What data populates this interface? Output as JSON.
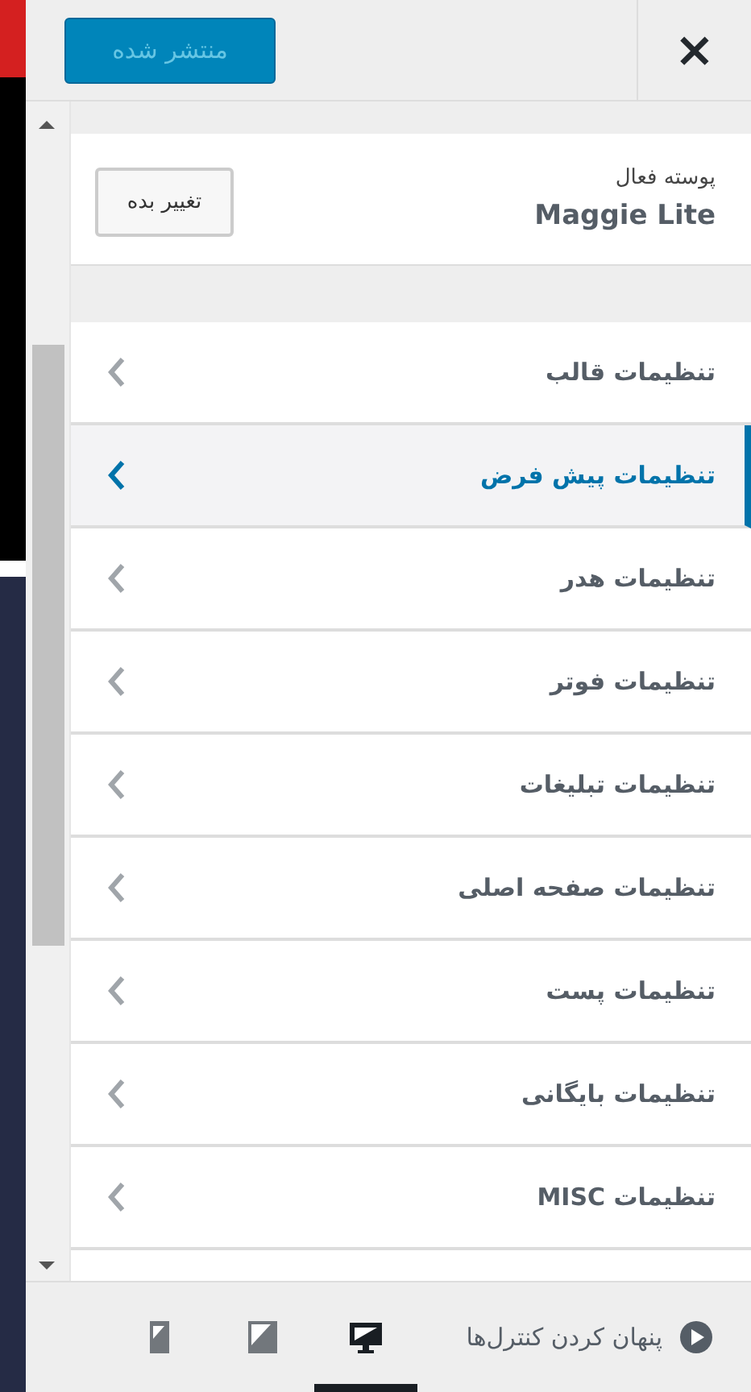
{
  "header": {
    "close": "×",
    "publish_button": "منتشر شده"
  },
  "active_theme": {
    "label": "پوسته فعال",
    "name": "Maggie Lite",
    "change_button": "تغییر بده"
  },
  "menu": [
    {
      "label": "تنظیمات قالب",
      "selected": false
    },
    {
      "label": "تنظیمات پیش فرض",
      "selected": true
    },
    {
      "label": "تنظیمات هدر",
      "selected": false
    },
    {
      "label": "تنظیمات فوتر",
      "selected": false
    },
    {
      "label": "تنظیمات تبلیغات",
      "selected": false
    },
    {
      "label": "تنظیمات صفحه اصلی",
      "selected": false
    },
    {
      "label": "تنظیمات پست",
      "selected": false
    },
    {
      "label": "تنظیمات بایگانی",
      "selected": false
    },
    {
      "label": "تنظیمات MISC",
      "selected": false
    }
  ],
  "footer": {
    "hide_controls": "پنهان کردن کنترل‌ها",
    "devices": [
      {
        "kind": "desktop",
        "selected": true
      },
      {
        "kind": "tablet",
        "selected": false
      },
      {
        "kind": "mobile",
        "selected": false
      }
    ]
  }
}
